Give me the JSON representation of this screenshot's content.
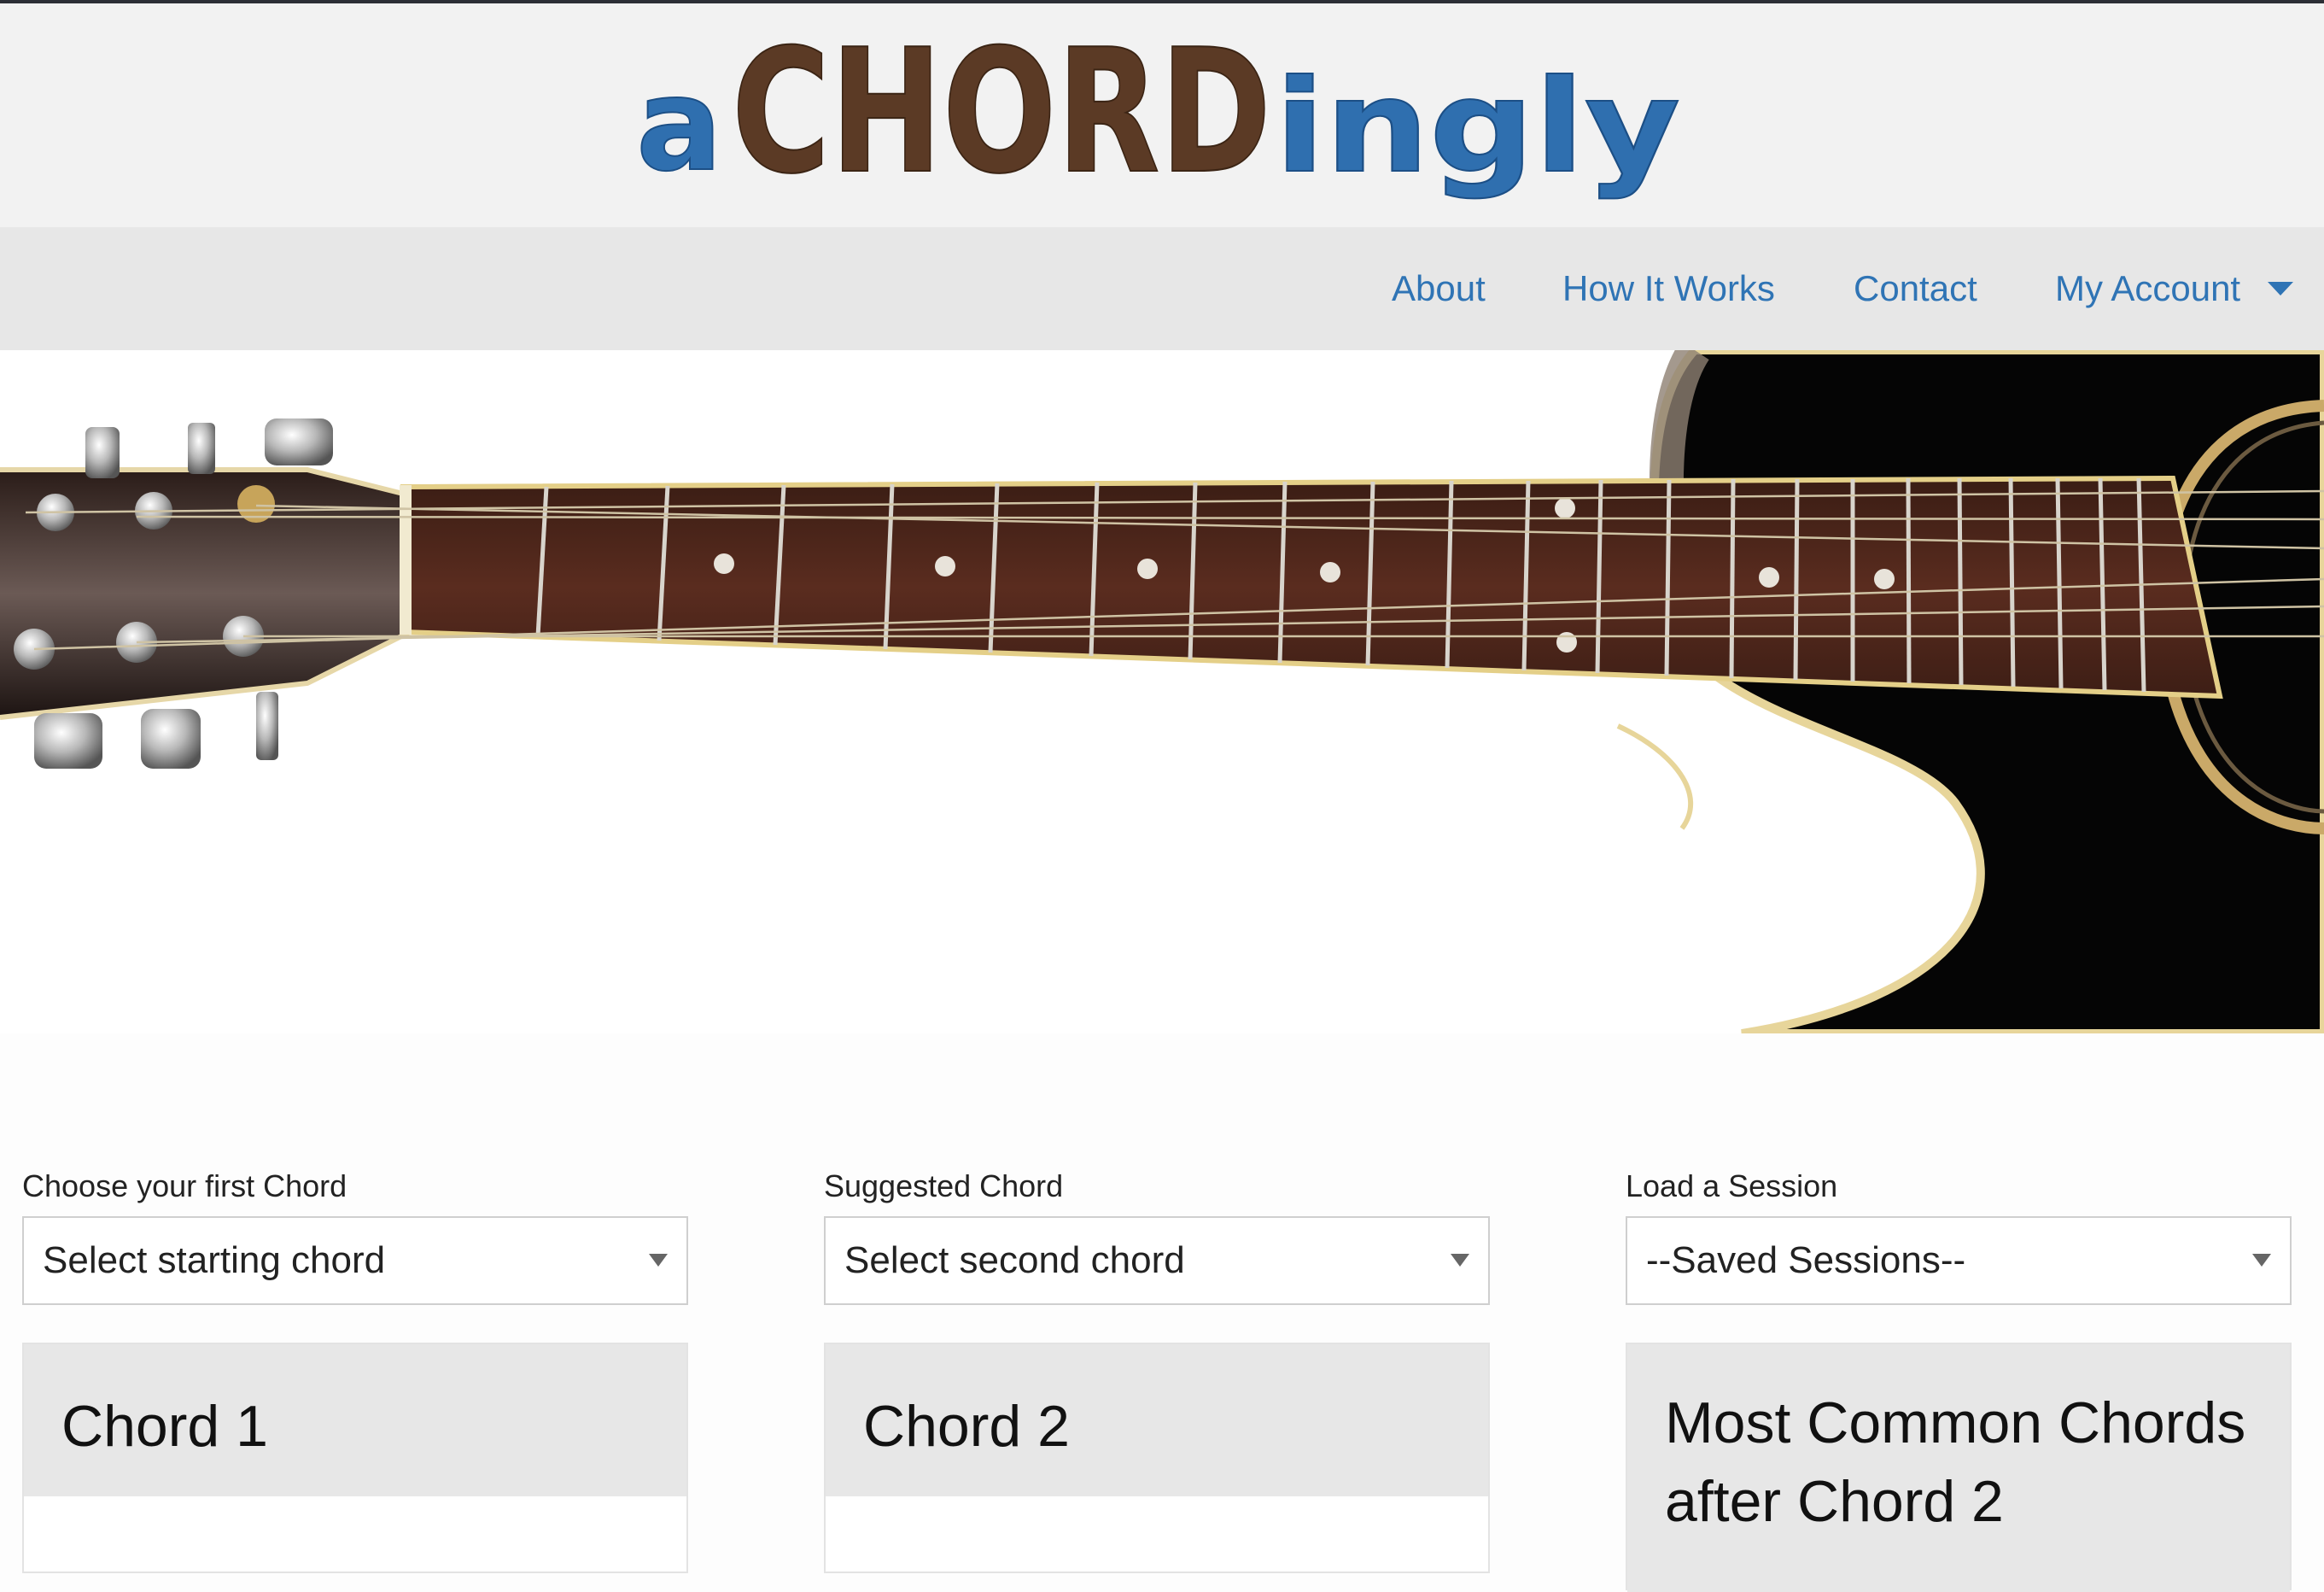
{
  "logo": {
    "part_a": "a",
    "part_chord": "CHORD",
    "part_ingly": "ingly",
    "colors": {
      "blue": "#2f6faf",
      "brown": "#5b3a25"
    }
  },
  "nav": {
    "items": [
      {
        "label": "About"
      },
      {
        "label": "How It Works"
      },
      {
        "label": "Contact"
      },
      {
        "label": "My Account"
      }
    ],
    "account_icon": "caret-down-icon"
  },
  "hero": {
    "image": "acoustic-guitar-neck"
  },
  "columns": [
    {
      "label": "Choose your first Chord",
      "select_value": "Select starting chord",
      "panel_title": "Chord 1"
    },
    {
      "label": "Suggested Chord",
      "select_value": "Select second chord",
      "panel_title": "Chord 2"
    },
    {
      "label": "Load a Session",
      "select_value": "--Saved Sessions--",
      "panel_title": "Most Common Chords after Chord 2"
    }
  ]
}
